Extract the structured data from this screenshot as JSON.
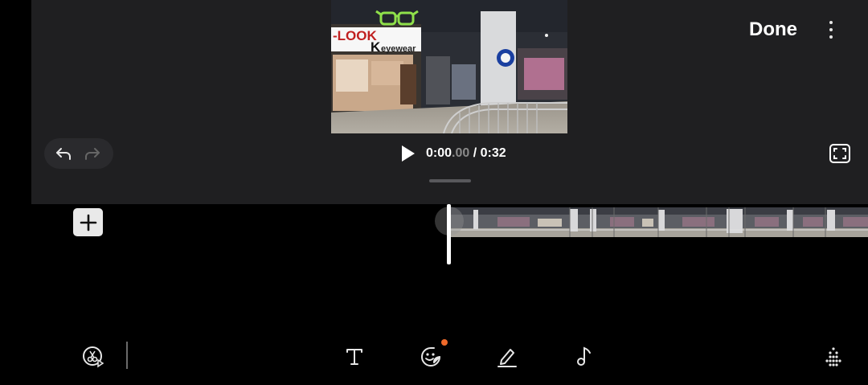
{
  "header": {
    "done_label": "Done",
    "more_icon": "more-vertical-icon"
  },
  "preview": {
    "sign_text": "-LOOK",
    "sign_text_2": "K",
    "sign_brand": "eyewear"
  },
  "playback": {
    "current_main": "0:00",
    "current_fraction": ".00",
    "separator": " / ",
    "duration": "0:32",
    "play_icon": "play-icon",
    "fullscreen_icon": "fullscreen-icon"
  },
  "history": {
    "undo_icon": "undo-icon",
    "redo_icon": "redo-icon"
  },
  "timeline": {
    "add_icon": "plus-icon"
  },
  "toolbar": {
    "tools": [
      {
        "name": "trim-tool",
        "icon": "scissors-icon"
      },
      {
        "name": "text-tool",
        "icon": "text-icon"
      },
      {
        "name": "sticker-tool",
        "icon": "sticker-icon",
        "has_badge": true
      },
      {
        "name": "draw-tool",
        "icon": "pen-icon"
      },
      {
        "name": "music-tool",
        "icon": "music-note-icon"
      },
      {
        "name": "more-tools",
        "icon": "dots-grid-icon"
      }
    ]
  },
  "colors": {
    "panel_bg": "#1f1f21",
    "badge": "#f06a2a",
    "sign_green": "#8fe04a"
  }
}
